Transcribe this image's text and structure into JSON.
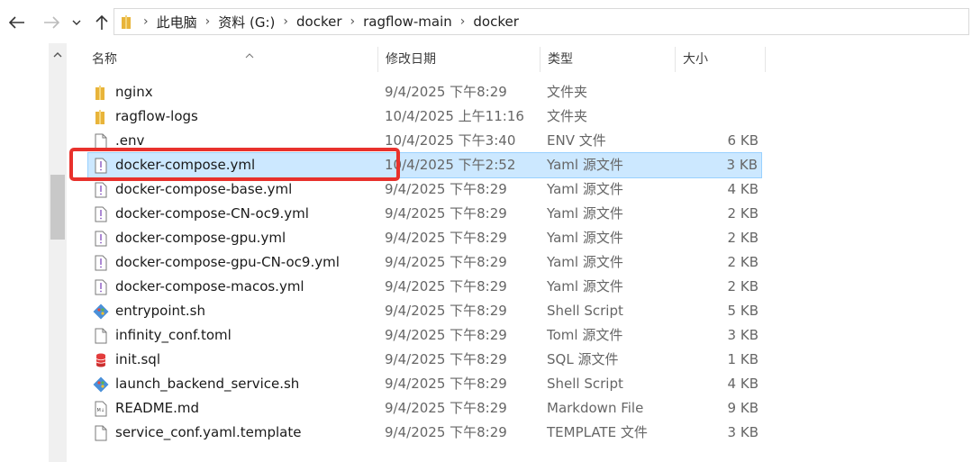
{
  "nav": {
    "back_icon": "arrow-left-icon",
    "forward_icon": "arrow-right-icon",
    "recent_icon": "chevron-down-icon",
    "up_icon": "arrow-up-icon"
  },
  "address": {
    "crumbs": [
      "此电脑",
      "资料 (G:)",
      "docker",
      "ragflow-main",
      "docker"
    ]
  },
  "columns": {
    "name": "名称",
    "date": "修改日期",
    "type": "类型",
    "size": "大小"
  },
  "files": [
    {
      "name": "nginx",
      "date": "9/4/2025 下午8:29",
      "type": "文件夹",
      "size": "",
      "icon": "folder-icon"
    },
    {
      "name": "ragflow-logs",
      "date": "10/4/2025 上午11:16",
      "type": "文件夹",
      "size": "",
      "icon": "folder-icon"
    },
    {
      "name": ".env",
      "date": "10/4/2025 下午3:40",
      "type": "ENV 文件",
      "size": "6 KB",
      "icon": "file-icon"
    },
    {
      "name": "docker-compose.yml",
      "date": "10/4/2025 下午2:52",
      "type": "Yaml 源文件",
      "size": "3 KB",
      "icon": "yaml-file-icon"
    },
    {
      "name": "docker-compose-base.yml",
      "date": "9/4/2025 下午8:29",
      "type": "Yaml 源文件",
      "size": "4 KB",
      "icon": "yaml-file-icon"
    },
    {
      "name": "docker-compose-CN-oc9.yml",
      "date": "9/4/2025 下午8:29",
      "type": "Yaml 源文件",
      "size": "2 KB",
      "icon": "yaml-file-icon"
    },
    {
      "name": "docker-compose-gpu.yml",
      "date": "9/4/2025 下午8:29",
      "type": "Yaml 源文件",
      "size": "2 KB",
      "icon": "yaml-file-icon"
    },
    {
      "name": "docker-compose-gpu-CN-oc9.yml",
      "date": "9/4/2025 下午8:29",
      "type": "Yaml 源文件",
      "size": "2 KB",
      "icon": "yaml-file-icon"
    },
    {
      "name": "docker-compose-macos.yml",
      "date": "9/4/2025 下午8:29",
      "type": "Yaml 源文件",
      "size": "2 KB",
      "icon": "yaml-file-icon"
    },
    {
      "name": "entrypoint.sh",
      "date": "9/4/2025 下午8:29",
      "type": "Shell Script",
      "size": "5 KB",
      "icon": "git-shell-icon"
    },
    {
      "name": "infinity_conf.toml",
      "date": "9/4/2025 下午8:29",
      "type": "Toml 源文件",
      "size": "3 KB",
      "icon": "file-icon"
    },
    {
      "name": "init.sql",
      "date": "9/4/2025 下午8:29",
      "type": "SQL 源文件",
      "size": "1 KB",
      "icon": "sql-file-icon"
    },
    {
      "name": "launch_backend_service.sh",
      "date": "9/4/2025 下午8:29",
      "type": "Shell Script",
      "size": "4 KB",
      "icon": "git-shell-icon"
    },
    {
      "name": "README.md",
      "date": "9/4/2025 下午8:29",
      "type": "Markdown File",
      "size": "9 KB",
      "icon": "markdown-file-icon"
    },
    {
      "name": "service_conf.yaml.template",
      "date": "9/4/2025 下午8:29",
      "type": "TEMPLATE 文件",
      "size": "3 KB",
      "icon": "file-icon"
    }
  ],
  "selected_index": 3,
  "colors": {
    "selection": "#cce8ff",
    "highlight_border": "#e8312c"
  }
}
